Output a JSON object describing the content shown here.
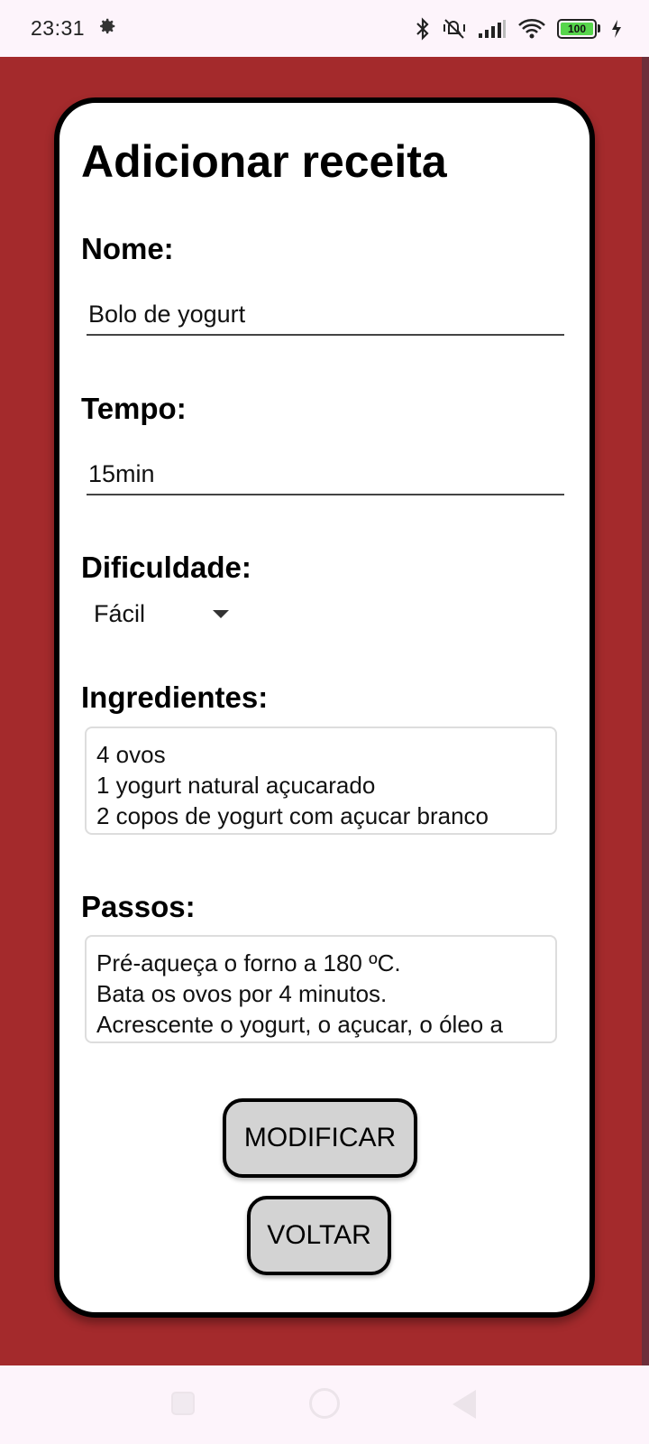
{
  "status_bar": {
    "time": "23:31",
    "battery_level": "100",
    "icons": [
      "settings-gear-icon",
      "bluetooth-icon",
      "mute-icon",
      "signal-icon",
      "wifi-icon",
      "battery-icon",
      "charging-icon"
    ]
  },
  "colors": {
    "background": "#a42a2c",
    "card": "#ffffff",
    "card_border": "#000000",
    "button": "#d3d3d3",
    "battery": "#57d64c"
  },
  "form": {
    "title": "Adicionar receita",
    "nome": {
      "label": "Nome:",
      "value": "Bolo de yogurt"
    },
    "tempo": {
      "label": "Tempo:",
      "value": "15min"
    },
    "dificuldade": {
      "label": "Dificuldade:",
      "selected": "Fácil"
    },
    "ingredientes": {
      "label": "Ingredientes:",
      "lines": [
        "4 ovos",
        "1 yogurt natural açucarado",
        "2 copos de yogurt com açucar branco"
      ]
    },
    "passos": {
      "label": "Passos:",
      "lines": [
        "Pré-aqueça o forno a 180 ºC.",
        "Bata os ovos por 4 minutos.",
        "Acrescente o yogurt, o açucar, o óleo a"
      ]
    },
    "buttons": {
      "modificar": "MODIFICAR",
      "voltar": "VOLTAR"
    }
  },
  "nav_bar": {
    "icons": [
      "recents-square-icon",
      "home-circle-icon",
      "back-triangle-icon"
    ]
  }
}
